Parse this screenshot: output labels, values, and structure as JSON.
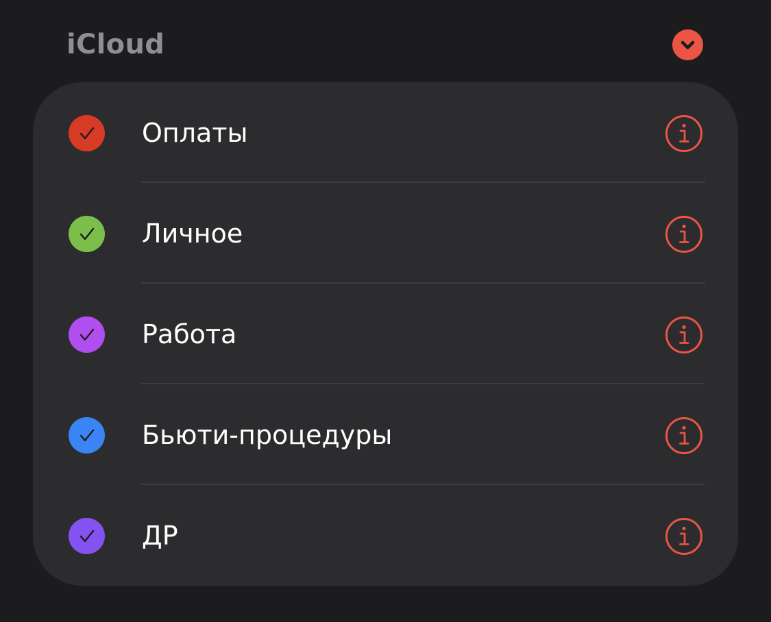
{
  "section": {
    "title": "iCloud",
    "collapse_icon": "chevron-down-icon",
    "accent_color": "#eb5545"
  },
  "calendars": [
    {
      "label": "Оплаты",
      "color": "#d83b25",
      "checked": true,
      "icon": "checkmark-icon",
      "info_icon": "info-icon"
    },
    {
      "label": "Личное",
      "color": "#7bbf4a",
      "checked": true,
      "icon": "checkmark-icon",
      "info_icon": "info-icon"
    },
    {
      "label": "Работа",
      "color": "#b04ef0",
      "checked": true,
      "icon": "checkmark-icon",
      "info_icon": "info-icon"
    },
    {
      "label": "Бьюти-процедуры",
      "color": "#3a84f5",
      "checked": true,
      "icon": "checkmark-icon",
      "info_icon": "info-icon"
    },
    {
      "label": "ДР",
      "color": "#8352f0",
      "checked": true,
      "icon": "checkmark-icon",
      "info_icon": "info-icon"
    }
  ]
}
